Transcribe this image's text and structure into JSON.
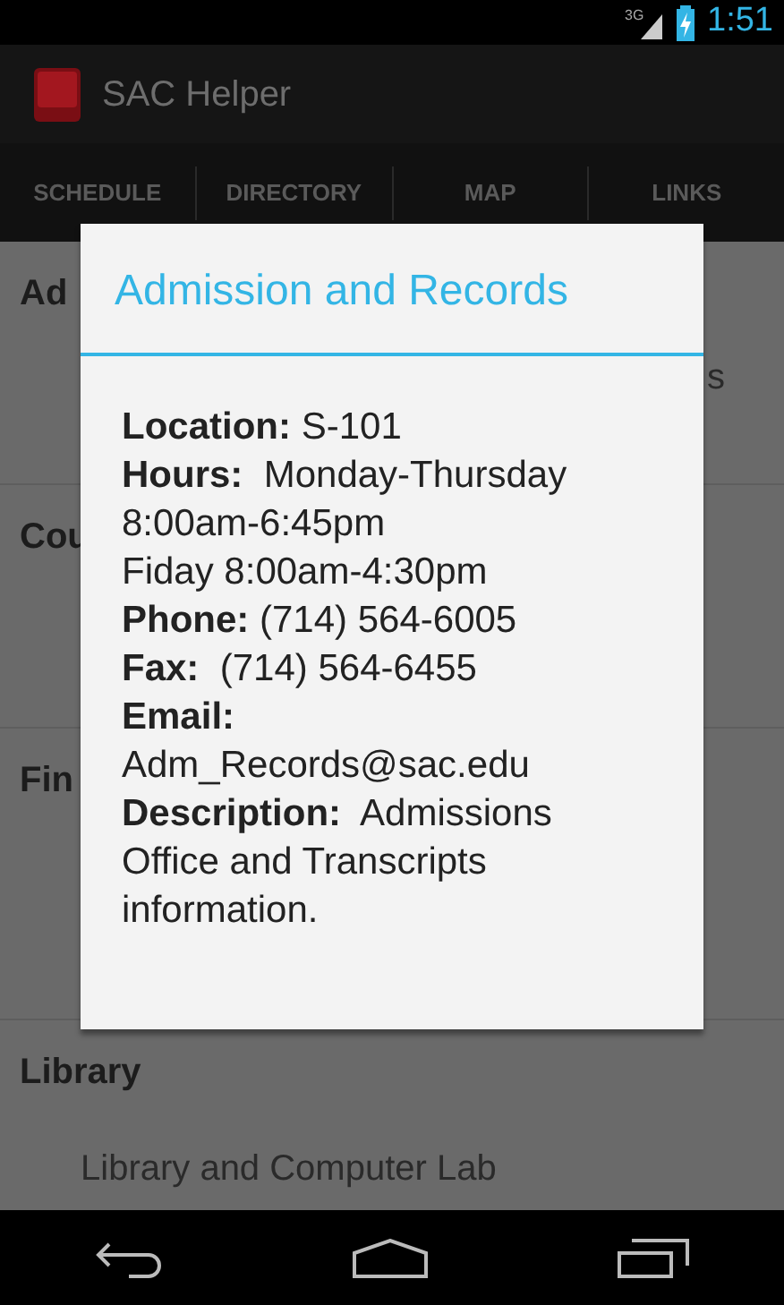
{
  "status_bar": {
    "network": "3G",
    "time": "1:51"
  },
  "action_bar": {
    "title": "SAC Helper"
  },
  "tabs": [
    {
      "label": "SCHEDULE"
    },
    {
      "label": "DIRECTORY"
    },
    {
      "label": "MAP"
    },
    {
      "label": "LINKS"
    }
  ],
  "list": [
    {
      "header": "Ad",
      "subtitle": "s"
    },
    {
      "header": "Cou"
    },
    {
      "header": "Fin"
    },
    {
      "header": "Library",
      "subtitle": "Library and Computer Lab"
    }
  ],
  "dialog": {
    "title": "Admission and Records",
    "lines": [
      "**Location:** S-101",
      "**Hours:**  Monday-Thursday 8:00am-6:45pm",
      "Fiday 8:00am-4:30pm",
      "**Phone:** (714) 564-6005",
      "**Fax:**  (714) 564-6455",
      "**Email:** Adm_Records@sac.edu",
      "**Description:**  Admissions Office and Transcripts information."
    ]
  }
}
